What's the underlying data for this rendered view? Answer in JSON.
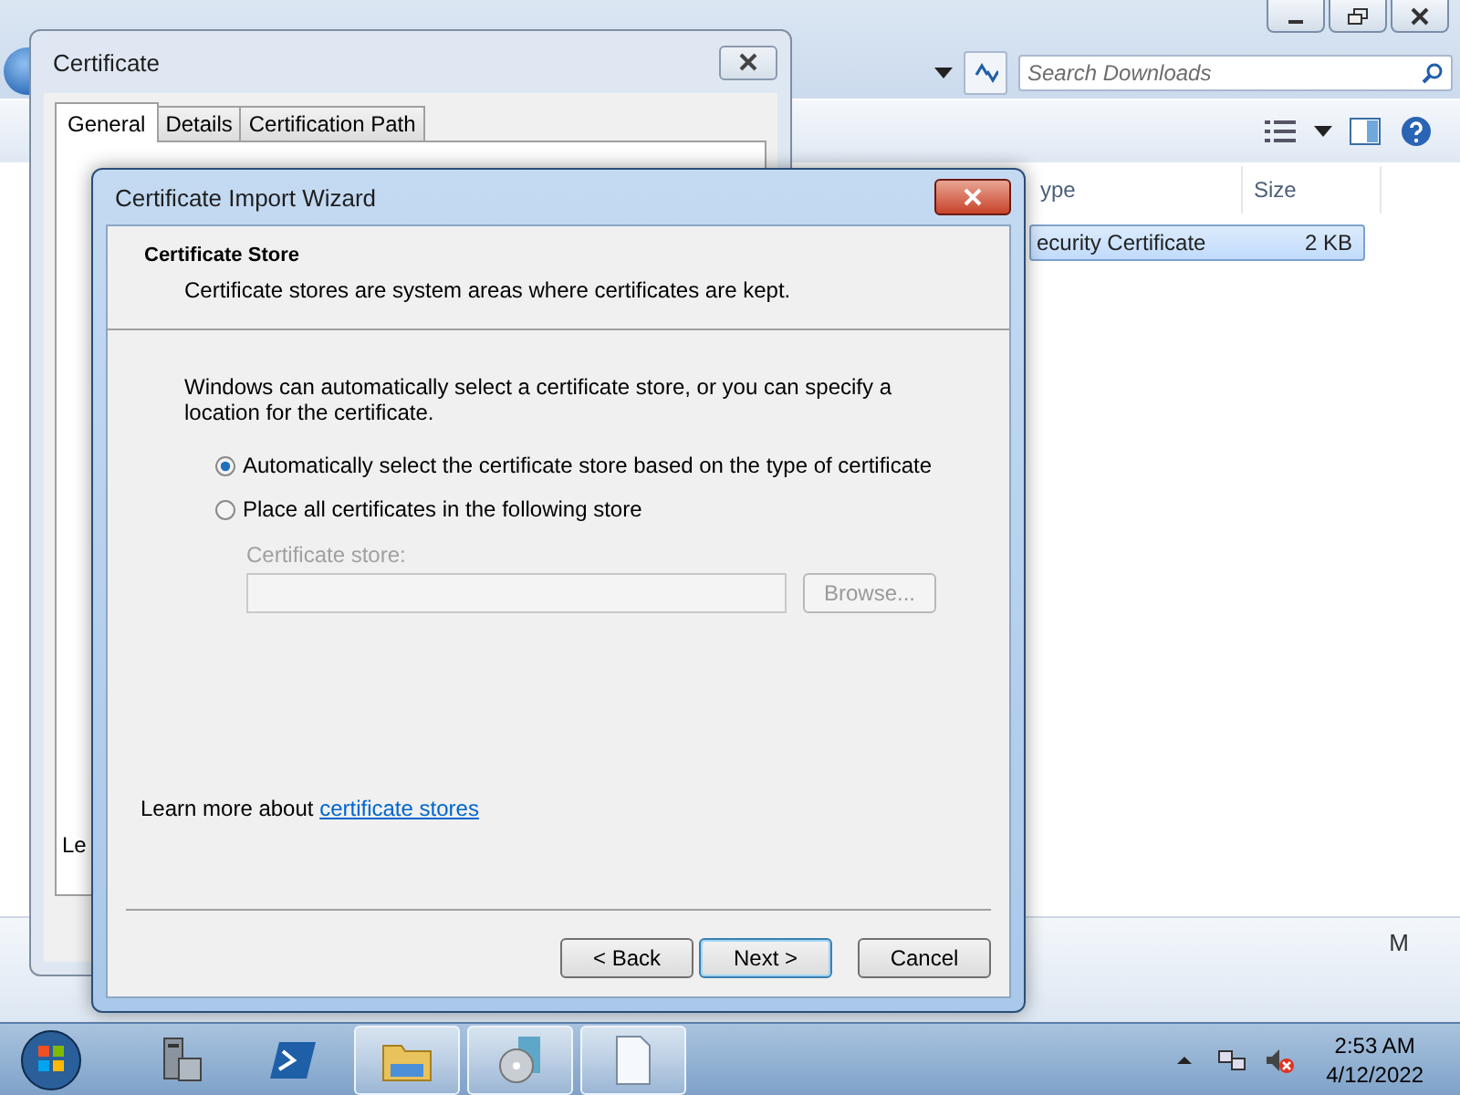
{
  "explorer": {
    "search": {
      "placeholder": "Search Downloads"
    },
    "columns": [
      "ype",
      "Size"
    ],
    "rows": [
      {
        "cells": [
          "ecurity Certificate",
          "2 KB"
        ],
        "selected": true
      }
    ],
    "partial_text": "M"
  },
  "certificate": {
    "title": "Certificate",
    "tabs": [
      {
        "label": "General",
        "selected": true
      },
      {
        "label": "Details",
        "selected": false
      },
      {
        "label": "Certification Path",
        "selected": false
      }
    ],
    "partial_text": "Le"
  },
  "wizard": {
    "title": "Certificate Import Wizard",
    "heading": "Certificate Store",
    "subheading": "Certificate stores are system areas where certificates are kept.",
    "intro": "Windows can automatically select a certificate store, or you can specify a location for the certificate.",
    "options": [
      {
        "label": "Automatically select the certificate store based on the type of certificate",
        "selected": true
      },
      {
        "label": "Place all certificates in the following store",
        "selected": false
      }
    ],
    "store": {
      "label": "Certificate store:",
      "disabled": true
    },
    "browse": {
      "label": "Browse...",
      "disabled": true
    },
    "learn_more": {
      "text": "Learn more about",
      "link": "certificate stores"
    },
    "buttons": [
      {
        "label": "< Back",
        "default": false
      },
      {
        "label": "Next >",
        "default": true
      },
      {
        "label": "Cancel",
        "default": false
      }
    ]
  },
  "taskbar": {
    "apps": [
      {
        "kind": "server",
        "running": false
      },
      {
        "kind": "powershell",
        "running": false
      },
      {
        "kind": "folder",
        "running": true
      },
      {
        "kind": "disc",
        "running": true
      },
      {
        "kind": "document",
        "running": true
      }
    ],
    "time": "2:53 AM",
    "date": "4/12/2022"
  }
}
